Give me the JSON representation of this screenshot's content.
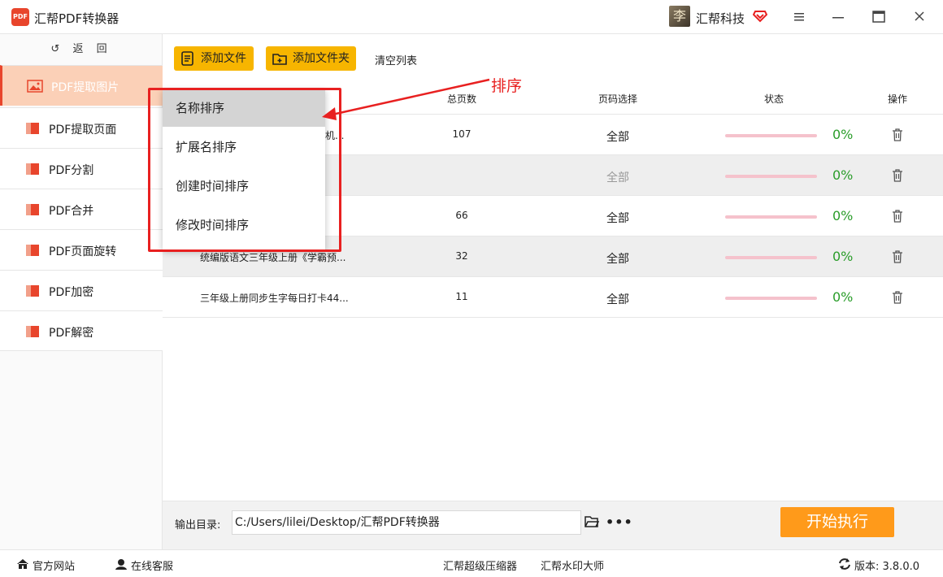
{
  "window": {
    "title": "汇帮PDF转换器",
    "brand": "汇帮科技",
    "logo_text": "PDF",
    "avatar_char": "李"
  },
  "sidebar": {
    "back_label": "返 回",
    "items": [
      {
        "label": "PDF提取图片",
        "active": true
      },
      {
        "label": "PDF提取页面"
      },
      {
        "label": "PDF分割"
      },
      {
        "label": "PDF合并"
      },
      {
        "label": "PDF页面旋转"
      },
      {
        "label": "PDF加密"
      },
      {
        "label": "PDF解密"
      }
    ]
  },
  "toolbar": {
    "add_file": "添加文件",
    "add_folder": "添加文件夹",
    "clear_list": "清空列表"
  },
  "table": {
    "headers": {
      "pages": "总页数",
      "range": "页码选择",
      "status": "状态",
      "action": "操作"
    },
    "rows": [
      {
        "name": "机...",
        "pages": "107",
        "range": "全部",
        "progress": 0,
        "percent": "0%"
      },
      {
        "name": "",
        "pages": "",
        "range": "全部",
        "progress": 0,
        "percent": "0%"
      },
      {
        "name": "",
        "pages": "66",
        "range": "全部",
        "progress": 0,
        "percent": "0%"
      },
      {
        "name": "统编版语文三年级上册《学霸预...",
        "pages": "32",
        "range": "全部",
        "progress": 0,
        "percent": "0%"
      },
      {
        "name": "三年级上册同步生字每日打卡44...",
        "pages": "11",
        "range": "全部",
        "progress": 0,
        "percent": "0%"
      }
    ]
  },
  "sort_menu": {
    "items": [
      "名称排序",
      "扩展名排序",
      "创建时间排序",
      "修改时间排序"
    ],
    "annotation": "排序"
  },
  "output": {
    "label": "输出目录:",
    "path": "C:/Users/lilei/Desktop/汇帮PDF转换器",
    "more": "•••",
    "start": "开始执行"
  },
  "footer": {
    "website": "官方网站",
    "support": "在线客服",
    "compressor": "汇帮超级压缩器",
    "watermark": "汇帮水印大师",
    "version": "版本: 3.8.0.0"
  },
  "colors": {
    "accent_orange": "#f7b500",
    "start_button": "#ff9a1a",
    "active_sidebar": "#fbd0b7",
    "annotation_red": "#e82020",
    "progress_green": "#2a9d2a"
  }
}
